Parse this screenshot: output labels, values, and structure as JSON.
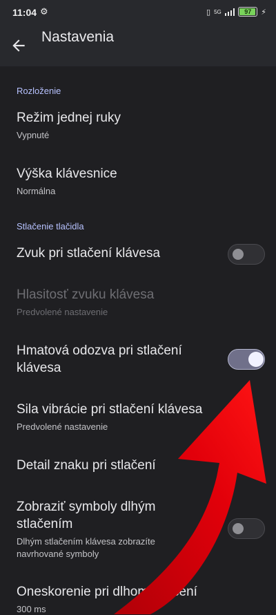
{
  "status": {
    "time": "11:04",
    "network": "5G",
    "battery": "97"
  },
  "header": {
    "title": "Nastavenia"
  },
  "sections": {
    "layout_header": "Rozloženie",
    "keypress_header": "Stlačenie tlačidla"
  },
  "settings": {
    "one_hand": {
      "title": "Režim jednej ruky",
      "subtitle": "Vypnuté"
    },
    "kb_height": {
      "title": "Výška klávesnice",
      "subtitle": "Normálna"
    },
    "sound": {
      "title": "Zvuk pri stlačení klávesa",
      "enabled": false
    },
    "volume": {
      "title": "Hlasitosť zvuku klávesa",
      "subtitle": "Predvolené nastavenie"
    },
    "haptic": {
      "title_line1": "Hmatová odozva pri stlačení",
      "title_line2": "klávesa",
      "enabled": true
    },
    "vibration": {
      "title": "Sila vibrácie pri stlačení klávesa",
      "subtitle": "Predvolené nastavenie"
    },
    "popup": {
      "title": "Detail znaku pri stlačení"
    },
    "longpress_symbols": {
      "title_line1": "Zobraziť symboly dlhým",
      "title_line2": "stlačením",
      "subtitle_line1": "Dlhým stlačením klávesa zobrazíte",
      "subtitle_line2": "navrhované symboly",
      "enabled": false
    },
    "longpress_delay": {
      "title": "Oneskorenie pri dlhom stlačení",
      "subtitle": "300 ms"
    }
  },
  "colors": {
    "background": "#1f1f22",
    "accent": "#b7c2ff",
    "annotation_arrow": "#e0000a"
  },
  "icons": {
    "back": "arrow-left-icon",
    "status_settings": "gear-icon",
    "annotation": "red-curved-arrow"
  }
}
